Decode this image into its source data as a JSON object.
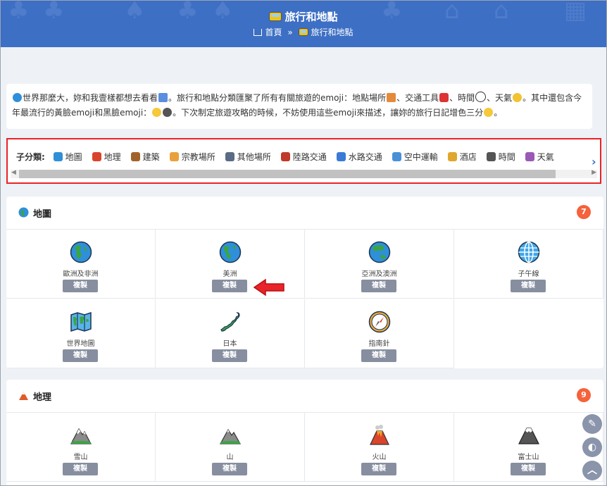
{
  "header": {
    "title": "旅行和地點",
    "crumb_home": "首頁",
    "crumb_sep": "»",
    "crumb_current": "旅行和地點"
  },
  "intro": {
    "text_1": "世界那麼大，妳和我壹樣都想去看看",
    "text_2": "。旅行和地點分類匯聚了所有有關旅遊的emoji：地點場所",
    "text_3": "、交通工具",
    "text_4": "、時間",
    "text_5": "、天氣",
    "text_6": "。其中還包含今年最流行的黃臉emoji和黑臉emoji：",
    "text_7": "。下次制定旅遊攻略的時候，不妨使用這些emoji來描述，讓妳的旅行日記增色三分",
    "text_8": "。"
  },
  "subcategories": {
    "label": "子分類:",
    "items": [
      {
        "label": "地圖",
        "color": "#2f8fd8"
      },
      {
        "label": "地理",
        "color": "#d9452b"
      },
      {
        "label": "建築",
        "color": "#a0642a"
      },
      {
        "label": "宗教場所",
        "color": "#e9a23b"
      },
      {
        "label": "其他場所",
        "color": "#5a6b86"
      },
      {
        "label": "陸路交通",
        "color": "#c0392b"
      },
      {
        "label": "水路交通",
        "color": "#3a7bd5"
      },
      {
        "label": "空中運輸",
        "color": "#4a90d9"
      },
      {
        "label": "酒店",
        "color": "#e0a72c"
      },
      {
        "label": "時間",
        "color": "#555555"
      },
      {
        "label": "天氣",
        "color": "#9b59b6"
      }
    ]
  },
  "sections": [
    {
      "name": "地圖",
      "count": "7",
      "items": [
        {
          "label": "歐洲及非洲",
          "icon": "globe-europe-africa-icon"
        },
        {
          "label": "美洲",
          "icon": "globe-americas-icon"
        },
        {
          "label": "亞洲及澳洲",
          "icon": "globe-asia-australia-icon"
        },
        {
          "label": "子午線",
          "icon": "globe-meridians-icon"
        },
        {
          "label": "世界地圖",
          "icon": "world-map-icon"
        },
        {
          "label": "日本",
          "icon": "japan-map-icon"
        },
        {
          "label": "指南針",
          "icon": "compass-icon"
        }
      ]
    },
    {
      "name": "地理",
      "count": "9",
      "items": [
        {
          "label": "雪山",
          "icon": "snow-mountain-icon"
        },
        {
          "label": "山",
          "icon": "mountain-icon"
        },
        {
          "label": "火山",
          "icon": "volcano-icon"
        },
        {
          "label": "富士山",
          "icon": "mount-fuji-icon"
        }
      ]
    }
  ],
  "copy_label": "複製",
  "fabs": {
    "edit": "✎",
    "theme": "◐",
    "top": "︿"
  }
}
